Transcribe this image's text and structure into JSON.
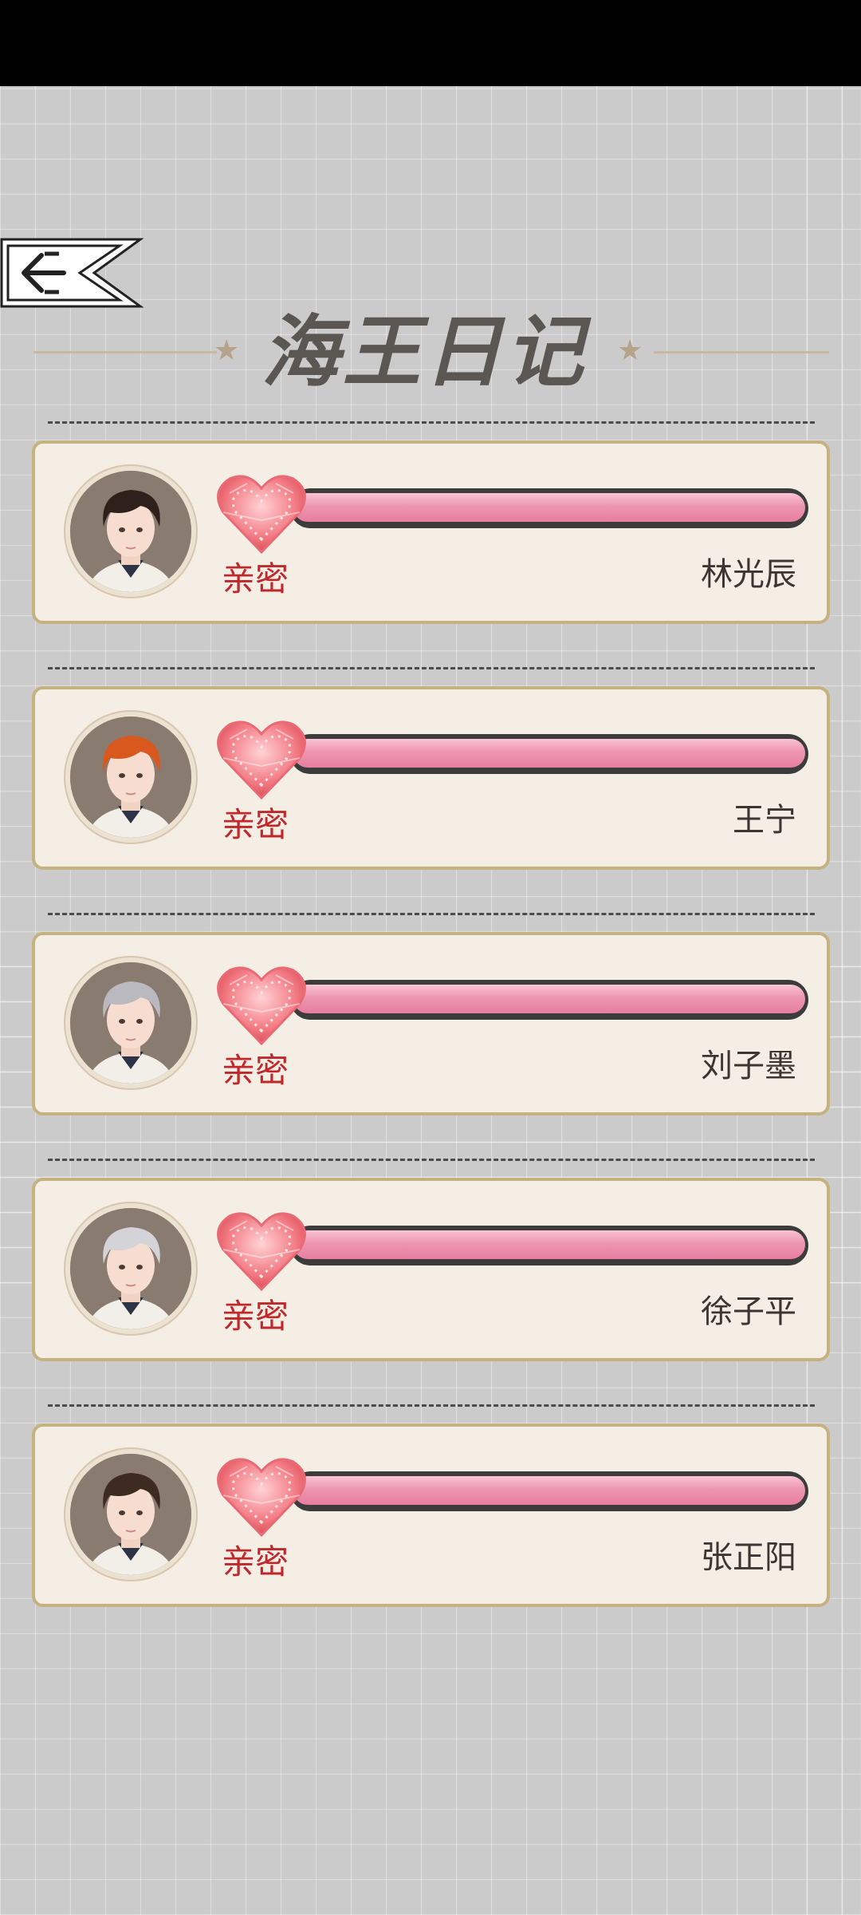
{
  "header": {
    "title": "海王日记",
    "back_icon": "arrow-left-icon"
  },
  "colors": {
    "background": "#cbcbcb",
    "card": "#f5eee4",
    "card_border": "#c6b181",
    "intimacy_label": "#c0282c",
    "bar_fill": "#ee96b2"
  },
  "characters": [
    {
      "name": "林光辰",
      "affection_label": "亲密",
      "affection_level": 1.0,
      "hair": "#2e211c"
    },
    {
      "name": "王宁",
      "affection_label": "亲密",
      "affection_level": 1.0,
      "hair": "#d8581e"
    },
    {
      "name": "刘子墨",
      "affection_label": "亲密",
      "affection_level": 1.0,
      "hair": "#b9b9bf"
    },
    {
      "name": "徐子平",
      "affection_label": "亲密",
      "affection_level": 1.0,
      "hair": "#d4d4d8"
    },
    {
      "name": "张正阳",
      "affection_label": "亲密",
      "affection_level": 1.0,
      "hair": "#3d2b22"
    }
  ]
}
